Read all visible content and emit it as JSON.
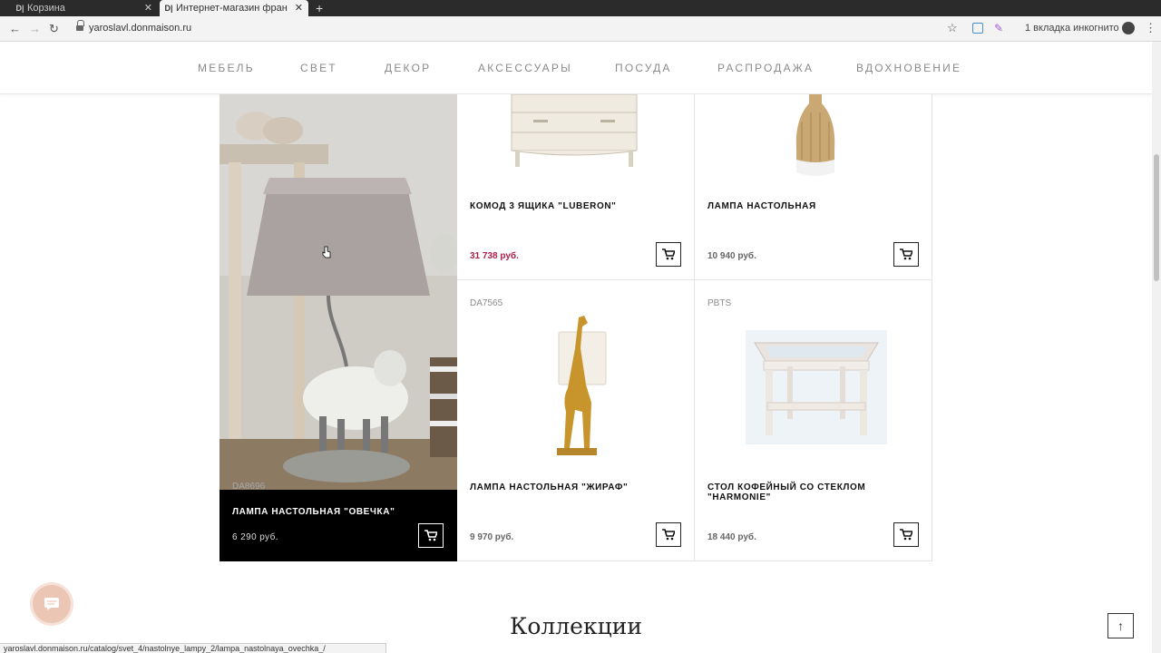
{
  "browser": {
    "tabs": [
      {
        "title": "Корзина",
        "favicon": "D|",
        "active": false
      },
      {
        "title": "Интернет-магазин фран",
        "favicon": "D|",
        "active": true
      }
    ],
    "url": "yaroslavl.donmaison.ru",
    "incognito_label": "1 вкладка инкогнито",
    "status_url": "yaroslavl.donmaison.ru/catalog/svet_4/nastolnye_lampy_2/lampa_nastolnaya_ovechka_/"
  },
  "nav": {
    "items": [
      "МЕБЕЛЬ",
      "СВЕТ",
      "ДЕКОР",
      "АКСЕССУАРЫ",
      "ПОСУДА",
      "РАСПРОДАЖА",
      "ВДОХНОВЕНИЕ"
    ]
  },
  "featured": {
    "sku": "DA8696",
    "name": "ЛАМПА НАСТОЛЬНАЯ \"ОВЕЧКА\"",
    "price": "6 290 руб."
  },
  "products": [
    {
      "sku": "",
      "name": "КОМОД 3 ЯЩИКА \"LUBERON\"",
      "price": "31 738 руб.",
      "sale": true,
      "image": "dresser"
    },
    {
      "sku": "",
      "name": "ЛАМПА НАСТОЛЬНАЯ",
      "price": "10 940 руб.",
      "sale": false,
      "image": "rattan-lamp"
    },
    {
      "sku": "DA7565",
      "name": "ЛАМПА НАСТОЛЬНАЯ \"ЖИРАФ\"",
      "price": "9 970 руб.",
      "sale": false,
      "image": "giraffe-lamp"
    },
    {
      "sku": "PBTS",
      "name": "СТОЛ КОФЕЙНЫЙ СО СТЕКЛОМ \"HARMONIE\"",
      "price": "18 440 руб.",
      "sale": false,
      "image": "coffee-table"
    }
  ],
  "section": {
    "title": "Коллекции"
  },
  "colors": {
    "sale": "#b0204a",
    "accent_chat": "#ecc6b4"
  }
}
